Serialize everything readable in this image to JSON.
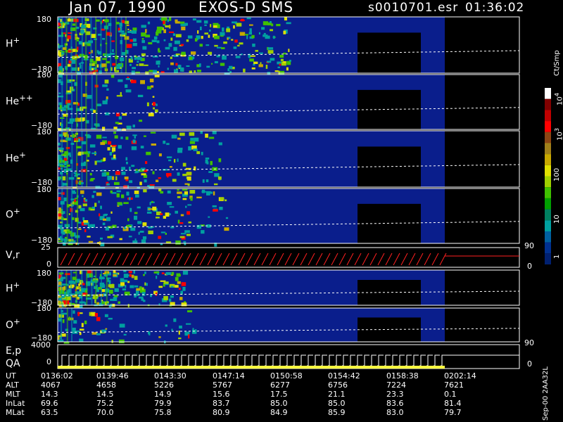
{
  "header": {
    "date": "Jan 07, 1990",
    "title": "EXOS-D SMS",
    "file": "s0010701.esr",
    "time": "01:36:02"
  },
  "panels": [
    {
      "label": "H",
      "sup": "+",
      "top": "180",
      "bottom": "−180"
    },
    {
      "label": "He",
      "sup": "++",
      "top": "180",
      "bottom": "−180"
    },
    {
      "label": "He",
      "sup": "+",
      "top": "180",
      "bottom": "−180"
    },
    {
      "label": "O",
      "sup": "+",
      "top": "180",
      "bottom": "−180"
    },
    {
      "label": "V,r",
      "sup": "",
      "top": "25",
      "bottom": "0"
    },
    {
      "label": "H",
      "sup": "+",
      "top": "180",
      "bottom": "−180"
    },
    {
      "label": "O",
      "sup": "+",
      "top": "180",
      "bottom": "−180"
    },
    {
      "label": "E,p",
      "sup": "",
      "top": "4000",
      "bottom": "0"
    }
  ],
  "qa_label": "QA",
  "right_ticks": {
    "vr_top": "90",
    "vr_bottom": "0",
    "o_bottom": "90",
    "ep_bottom": "0"
  },
  "colorbar": {
    "unit": "Ct/Smp",
    "labels": [
      {
        "text": "10",
        "sup": "4"
      },
      {
        "text": "10",
        "sup": "3"
      },
      {
        "text": "100",
        "sup": ""
      },
      {
        "text": "10",
        "sup": ""
      },
      {
        "text": "1",
        "sup": ""
      }
    ],
    "colors": [
      "#ffffff",
      "#800000",
      "#c00000",
      "#ff0000",
      "#8b4513",
      "#a0801a",
      "#c8a800",
      "#e0e000",
      "#a0d000",
      "#40c000",
      "#00a000",
      "#008060",
      "#00a0a0",
      "#0060a0",
      "#003090",
      "#002070"
    ]
  },
  "footer_code": "Sep-00  2AA32L",
  "table": {
    "row_labels": [
      "UT",
      "ALT",
      "MLT",
      "InLat",
      "MLat"
    ],
    "columns": [
      [
        "0136:02",
        "4067",
        "14.3",
        "69.6",
        "63.5"
      ],
      [
        "0139:46",
        "4658",
        "14.5",
        "75.2",
        "70.0"
      ],
      [
        "0143:30",
        "5226",
        "14.9",
        "79.9",
        "75.8"
      ],
      [
        "0147:14",
        "5767",
        "15.6",
        "83.7",
        "80.9"
      ],
      [
        "0150:58",
        "6277",
        "17.5",
        "85.0",
        "84.9"
      ],
      [
        "0154:42",
        "6756",
        "21.1",
        "85.0",
        "85.9"
      ],
      [
        "0158:38",
        "7224",
        "23.3",
        "83.6",
        "83.0"
      ],
      [
        "0202:14",
        "7621",
        "0.1",
        "81.4",
        "79.7"
      ]
    ]
  },
  "chart_data": {
    "type": "heatmap",
    "title": "EXOS-D SMS",
    "x_ticks": [
      "0136:02",
      "0139:46",
      "0143:30",
      "0147:14",
      "0150:58",
      "0154:42",
      "0158:38",
      "0202:14"
    ],
    "panels": [
      "H+",
      "He++",
      "He+",
      "O+",
      "V,r",
      "H+",
      "O+",
      "E,p"
    ],
    "colorbar_scale": "log",
    "colorbar_range": [
      1,
      10000
    ],
    "colorbar_unit": "Ct/Smp"
  }
}
